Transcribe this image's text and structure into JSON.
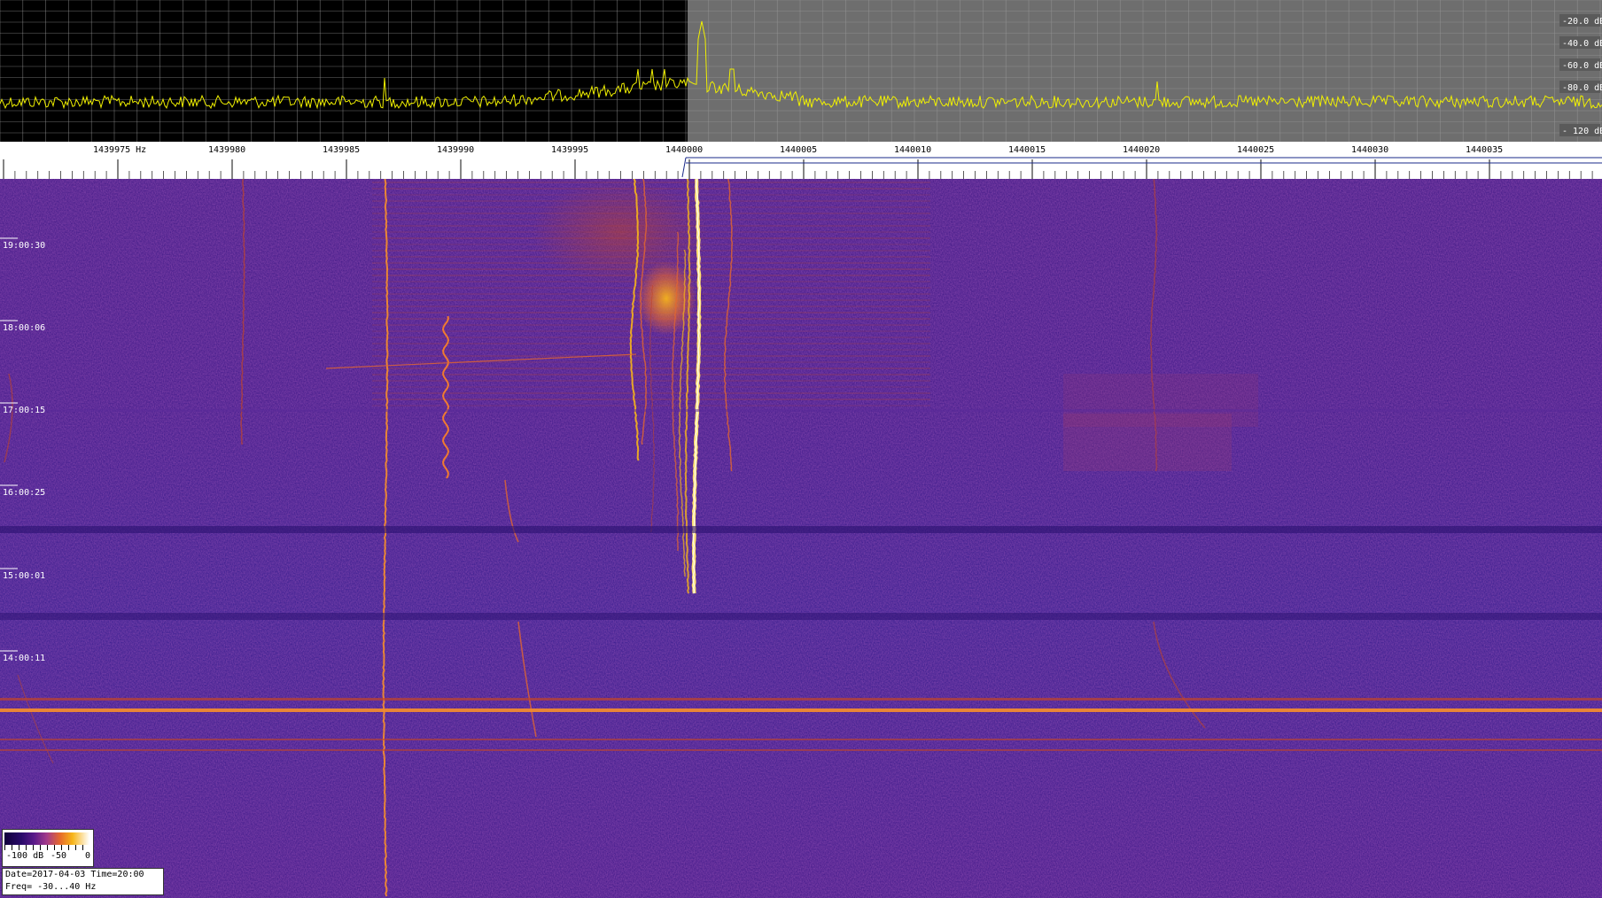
{
  "spectrum": {
    "db_labels": [
      "-20.0 dB",
      "-40.0 dB",
      "-60.0 dB",
      "-80.0 dB",
      "- 120 dB"
    ],
    "trace_color": "#f0f000",
    "background_left": "#000000",
    "background_right": "#6e6e6e"
  },
  "ruler": {
    "freq_labels": [
      "1439975 Hz",
      "1439980",
      "1439985",
      "1439990",
      "1439995",
      "1440000",
      "1440005",
      "1440010",
      "1440015",
      "1440020",
      "1440025",
      "1440030",
      "1440035"
    ]
  },
  "waterfall": {
    "time_labels": [
      "19:00:30",
      "18:00:06",
      "17:00:15",
      "16:00:25",
      "15:00:01",
      "14:00:11"
    ],
    "background": "#3a1a8a"
  },
  "colorbar": {
    "labels": [
      "-100 dB",
      "-50",
      "0"
    ]
  },
  "info": {
    "line1": "Date=2017-04-03 Time=20:00",
    "line2": "Freq= -30...40 Hz"
  }
}
